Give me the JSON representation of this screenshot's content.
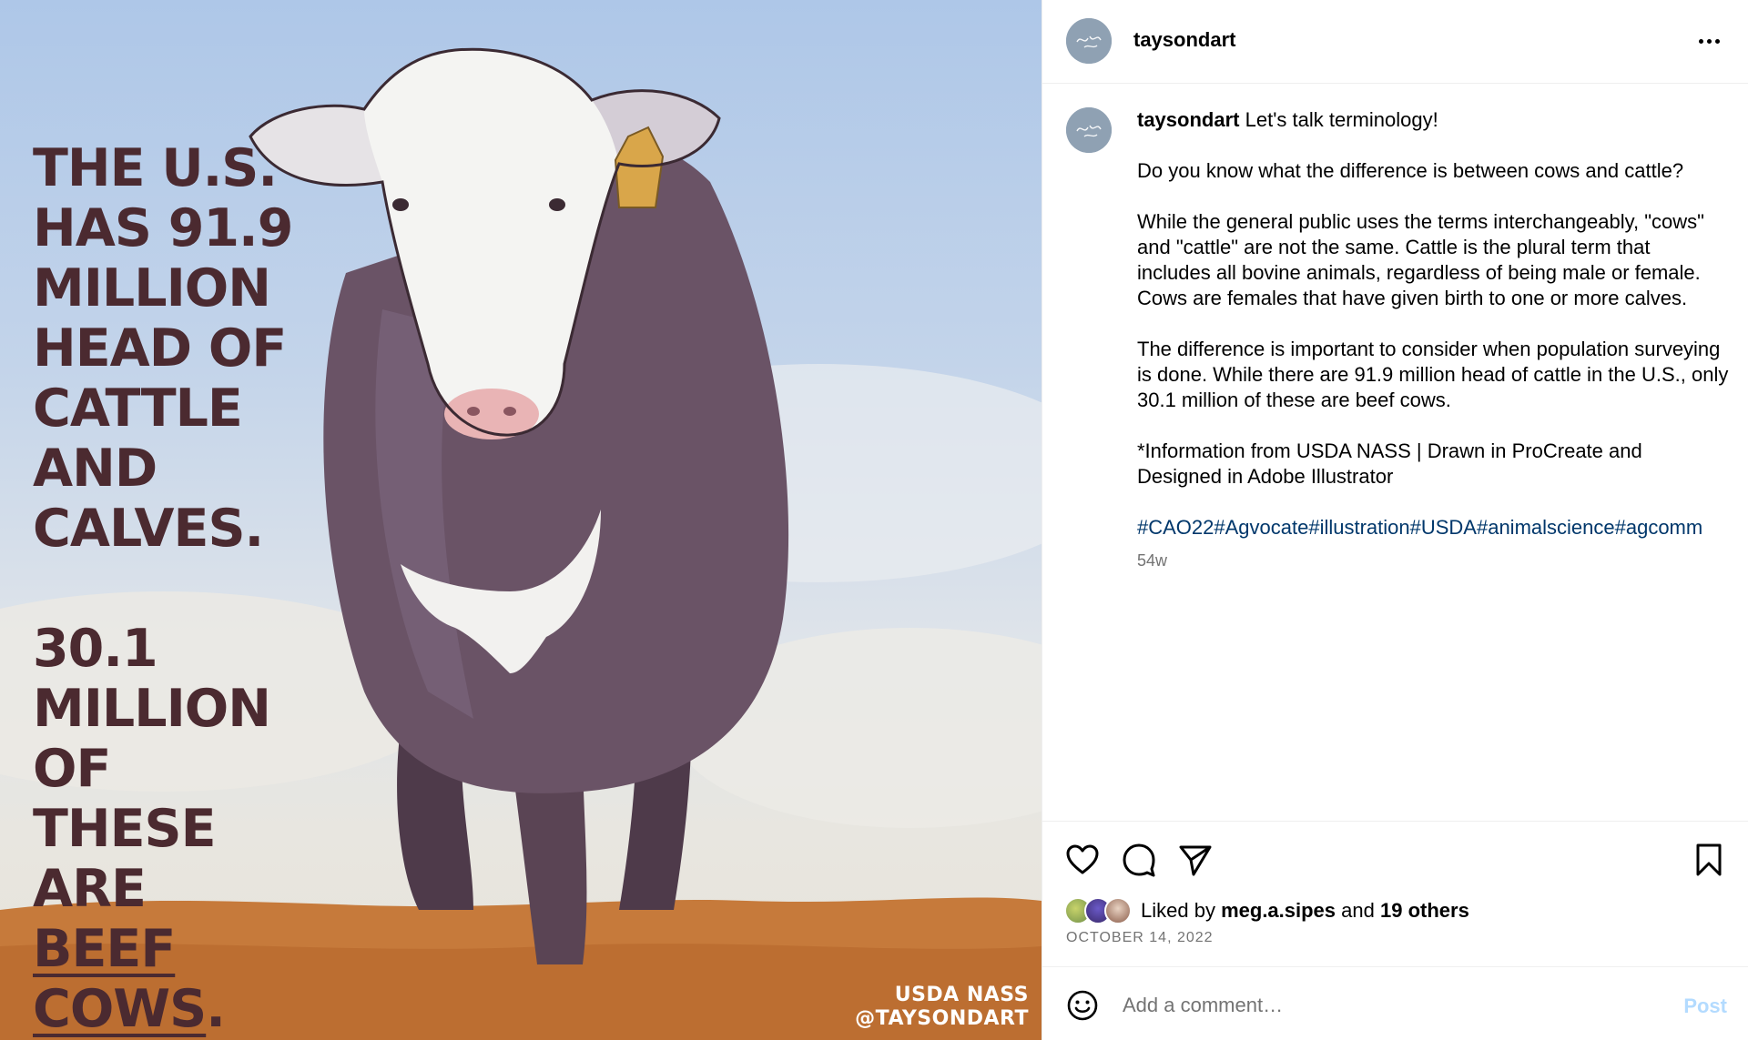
{
  "post_image": {
    "headline_lines": [
      "THE U.S.",
      "HAS 91.9",
      "MILLION",
      "HEAD OF",
      "CATTLE AND",
      "CALVES."
    ],
    "subline_lines": [
      "30.1",
      "MILLION OF",
      "THESE ARE"
    ],
    "emphasis_text": "BEEF COWS",
    "emphasis_suffix": ".",
    "credit_source": "USDA NASS",
    "credit_handle": "@TAYSONDART",
    "colors": {
      "text": "#4b2a30",
      "sky": "#aec7e8",
      "ground": "#c77a3a",
      "cow_body": "#5a4454",
      "ear_tag": "#d9a64a"
    }
  },
  "header": {
    "avatar_icon": "profile-avatar",
    "username": "taysondart",
    "more_icon": "more-options-icon"
  },
  "caption": {
    "username": "taysondart",
    "first_line": "Let's talk terminology!",
    "paragraphs": [
      "Do you know what the difference is between cows and cattle?",
      "While the general public uses the terms interchangeably, \"cows\" and \"cattle\" are not the same. Cattle is the plural term that includes all bovine animals, regardless of being male or female. Cows are females that have given birth to one or more calves.",
      "The difference is important to consider when population surveying is done. While there are 91.9 million head of cattle in the U.S., only 30.1 million of these are beef cows.",
      "*Information from USDA NASS | Drawn in ProCreate and Designed in Adobe Illustrator"
    ],
    "hashtags": "#CAO22#Agvocate#illustration#USDA#animalscience#agcomm",
    "age": "54w"
  },
  "actions": {
    "like_icon": "heart-icon",
    "comment_icon": "comment-icon",
    "share_icon": "send-icon",
    "save_icon": "bookmark-icon"
  },
  "likes": {
    "prefix": "Liked by",
    "user": "meg.a.sipes",
    "joiner": "and",
    "others": "19 others"
  },
  "date": "OCTOBER 14, 2022",
  "comment": {
    "emoji_icon": "emoji-icon",
    "placeholder": "Add a comment…",
    "post_label": "Post",
    "post_color": "#b3dbff"
  }
}
